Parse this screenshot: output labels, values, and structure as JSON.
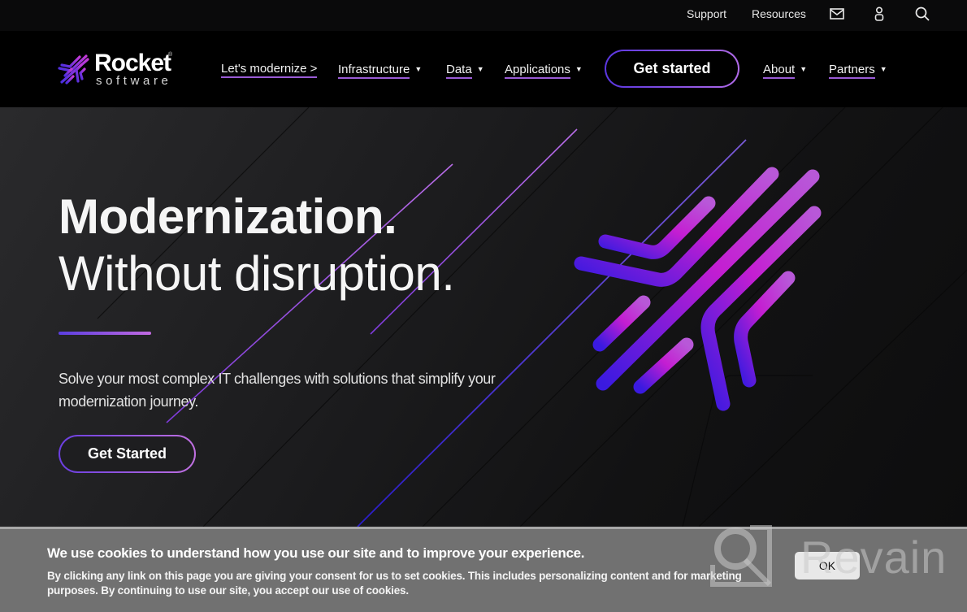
{
  "utility_bar": {
    "links": [
      "Support",
      "Resources"
    ],
    "icons": [
      "mail-icon",
      "user-icon",
      "search-icon"
    ]
  },
  "logo": {
    "word": "Rocket",
    "registered": "®",
    "sub": "software"
  },
  "nav": {
    "items": [
      {
        "label": "Let's modernize >",
        "has_dropdown": false
      },
      {
        "label": "Infrastructure",
        "has_dropdown": true
      },
      {
        "label": "Data",
        "has_dropdown": true
      },
      {
        "label": "Applications",
        "has_dropdown": true
      },
      {
        "label": "About",
        "has_dropdown": true
      },
      {
        "label": "Partners",
        "has_dropdown": true
      }
    ],
    "cta_label": "Get started",
    "caret": "▼"
  },
  "hero": {
    "headline_bold": "Modernization.",
    "headline_light": "Without disruption.",
    "subtext": "Solve your most complex IT challenges with solutions that simplify your modernization journey.",
    "cta_label": "Get Started"
  },
  "cookie_banner": {
    "title": "We use cookies to understand how you use our site and to improve your experience.",
    "body": "By clicking any link on this page you are giving your consent for us to set cookies. This includes personalizing content and for marketing purposes. By continuing to use our site, you accept our use of cookies.",
    "ok_label": "OK"
  },
  "watermark": {
    "text": "Revain"
  },
  "colors": {
    "accent_purple": "#b06ae8",
    "accent_blue": "#5a36e0",
    "magenta": "#c21fd0",
    "banner_gray": "#717171"
  }
}
